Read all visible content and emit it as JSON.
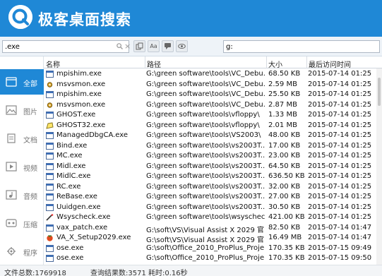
{
  "app": {
    "title": "极客桌面搜索"
  },
  "search": {
    "query": ".exe",
    "path_filter": "g:"
  },
  "toolbar": {
    "buttons": [
      {
        "icon": "copy-icon",
        "label": ""
      },
      {
        "icon": "font-case-icon",
        "label": "Aa"
      },
      {
        "icon": "comment-icon",
        "label": ""
      },
      {
        "icon": "preview-icon",
        "label": ""
      }
    ]
  },
  "sidebar": {
    "items": [
      {
        "label": "全部",
        "icon": "all-files-icon",
        "active": true
      },
      {
        "label": "图片",
        "icon": "image-icon",
        "active": false
      },
      {
        "label": "文档",
        "icon": "document-icon",
        "active": false
      },
      {
        "label": "视频",
        "icon": "video-icon",
        "active": false
      },
      {
        "label": "音频",
        "icon": "audio-icon",
        "active": false
      },
      {
        "label": "压缩",
        "icon": "archive-icon",
        "active": false
      },
      {
        "label": "程序",
        "icon": "program-icon",
        "active": false
      }
    ]
  },
  "table": {
    "columns": [
      "名称",
      "路径",
      "大小",
      "最后访问时间"
    ],
    "rows": [
      {
        "icon": "exe-window-icon",
        "name": "mpishim.exe",
        "path": "G:\\green software\\tools\\VC_Debu...",
        "size": "68.50 KB",
        "time": "2015-07-14 01:25"
      },
      {
        "icon": "exe-gear-icon",
        "name": "msvsmon.exe",
        "path": "G:\\green software\\tools\\VC_Debu...",
        "size": "2.59 MB",
        "time": "2015-07-14 01:25"
      },
      {
        "icon": "exe-window-icon",
        "name": "mpishim.exe",
        "path": "G:\\green software\\tools\\VC_Debu...",
        "size": "25.50 KB",
        "time": "2015-07-14 01:25"
      },
      {
        "icon": "exe-gear-icon",
        "name": "msvsmon.exe",
        "path": "G:\\green software\\tools\\VC_Debu...",
        "size": "2.87 MB",
        "time": "2015-07-14 01:25"
      },
      {
        "icon": "exe-window-icon",
        "name": "GHOST.exe",
        "path": "G:\\green software\\tools\\vfloppy\\",
        "size": "1.33 MB",
        "time": "2015-07-14 01:25"
      },
      {
        "icon": "exe-ghost-icon",
        "name": "GHOST32.exe",
        "path": "G:\\green software\\tools\\vfloppy\\",
        "size": "2.01 MB",
        "time": "2015-07-14 01:25"
      },
      {
        "icon": "exe-window-icon",
        "name": "ManagedDbgCA.exe",
        "path": "G:\\green software\\tools\\VS2003\\",
        "size": "48.00 KB",
        "time": "2015-07-14 01:25"
      },
      {
        "icon": "exe-window-icon",
        "name": "Bind.exe",
        "path": "G:\\green software\\tools\\vs2003T...",
        "size": "17.00 KB",
        "time": "2015-07-14 01:25"
      },
      {
        "icon": "exe-window-icon",
        "name": "MC.exe",
        "path": "G:\\green software\\tools\\vs2003T...",
        "size": "23.00 KB",
        "time": "2015-07-14 01:25"
      },
      {
        "icon": "exe-window-icon",
        "name": "Midl.exe",
        "path": "G:\\green software\\tools\\vs2003T...",
        "size": "64.50 KB",
        "time": "2015-07-14 01:25"
      },
      {
        "icon": "exe-window-icon",
        "name": "MidlC.exe",
        "path": "G:\\green software\\tools\\vs2003T...",
        "size": "636.50 KB",
        "time": "2015-07-14 01:25"
      },
      {
        "icon": "exe-window-icon",
        "name": "RC.exe",
        "path": "G:\\green software\\tools\\vs2003T...",
        "size": "32.00 KB",
        "time": "2015-07-14 01:25"
      },
      {
        "icon": "exe-window-icon",
        "name": "ReBase.exe",
        "path": "G:\\green software\\tools\\vs2003T...",
        "size": "27.00 KB",
        "time": "2015-07-14 01:25"
      },
      {
        "icon": "exe-window-icon",
        "name": "Uuidgen.exe",
        "path": "G:\\green software\\tools\\vs2003T...",
        "size": "30.50 KB",
        "time": "2015-07-14 01:25"
      },
      {
        "icon": "exe-wand-icon",
        "name": "Wsyscheck.exe",
        "path": "G:\\green software\\tools\\wsyschec...",
        "size": "421.00 KB",
        "time": "2015-07-14 01:25"
      },
      {
        "icon": "exe-window-icon",
        "name": "vax_patch.exe",
        "path": "G:\\soft\\VS\\Visual Assist X 2029 官...",
        "size": "82.50 KB",
        "time": "2015-07-14 01:47"
      },
      {
        "icon": "exe-tomato-icon",
        "name": "VA_X_Setup2029.exe",
        "path": "G:\\soft\\VS\\Visual Assist X 2029 官...",
        "size": "16.49 MB",
        "time": "2015-07-14 01:47"
      },
      {
        "icon": "exe-window-icon",
        "name": "ose.exe",
        "path": "G:\\soft\\Office_2010_ProPlus_Proje...",
        "size": "170.35 KB",
        "time": "2015-07-15 09:49"
      },
      {
        "icon": "exe-window-icon",
        "name": "ose.exe",
        "path": "G:\\soft\\Office_2010_ProPlus_Proje...",
        "size": "170.35 KB",
        "time": "2015-07-15 09:50"
      }
    ]
  },
  "status": {
    "total_files": "文件总数:1769918",
    "results": "查询结果数:3571",
    "elapsed": "耗时:0.16秒"
  },
  "colors": {
    "accent": "#1f88d6"
  }
}
